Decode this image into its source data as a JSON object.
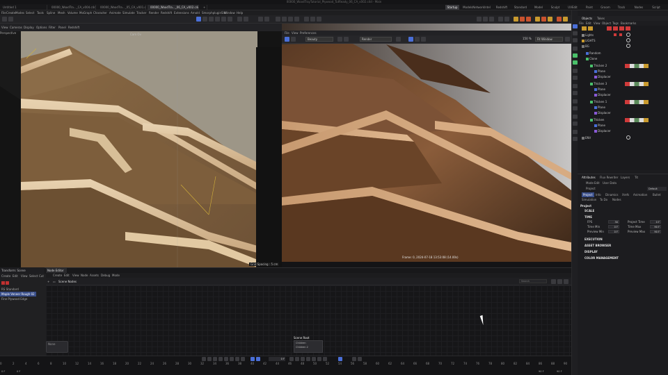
{
  "window": {
    "title": "00000_WoodTrayTutorial_Plywood_TutReady_06_CA_v002.c4d - Main"
  },
  "doc_tabs": [
    "Untitled 1",
    "00000_WoodTra..._CA_v004.c4d",
    "00000_WoodTra..._05_CA_v001.c4d",
    "00000_WoodTra..._06_CA_v002.c4d",
    "+"
  ],
  "layout_tabs": [
    "Startup",
    "ModelsNetworkIntel",
    "Redshift",
    "Standard",
    "Model",
    "Sculpt",
    "UVEdit",
    "Paint",
    "Groom",
    "Track",
    "Nodes",
    "Script"
  ],
  "menus": [
    "File",
    "Create",
    "Modes",
    "Select",
    "Tools",
    "Spline",
    "Mesh",
    "Volume",
    "MoGraph",
    "Character",
    "Animate",
    "Simulate",
    "Tracker",
    "Render",
    "Redshift",
    "Extensions",
    "Arnold",
    "SmorphpluginSite",
    "Window",
    "Help"
  ],
  "left_viewport": {
    "menu": [
      "View",
      "Cameras",
      "Display",
      "Options",
      "Filter",
      "Panel",
      "Redshift"
    ],
    "perspective_label": "Perspective",
    "camera_label": "Cam",
    "camera_value": "Ov",
    "grid_spacing": "Grid Spacing : 5 cm"
  },
  "right_viewport": {
    "menu": [
      "File",
      "View",
      "Preferences"
    ],
    "beauty_select": "Beauty",
    "render_label": "Render",
    "zoom": "150 %",
    "fit_label": "Fit Window",
    "frame_info": "Frame: 0,  2024-07-18  13:53:08  (14.00s)"
  },
  "node_editor": {
    "transform_tab": "Transform: Scene",
    "tab": "Node Editor",
    "menu": [
      "Create",
      "Edit",
      "View",
      "Node",
      "Assets",
      "Debug",
      "Mode"
    ],
    "breadcrumb": "Scene Nodes",
    "search_placeholder": "Search",
    "scene_root": "Scene Root",
    "children": [
      "Children",
      "Children 2"
    ],
    "none_node": "None",
    "left_menu": [
      "Create",
      "Edit",
      "View",
      "Select",
      "Cut"
    ],
    "left_items": [
      "RS Standard",
      "Maple Veneer Rough 02",
      "Fine Plywood Edge"
    ]
  },
  "timeline": {
    "ticks": [
      "0",
      "2",
      "4",
      "6",
      "8",
      "10",
      "12",
      "14",
      "16",
      "18",
      "20",
      "22",
      "24",
      "26",
      "28",
      "30",
      "32",
      "34",
      "36",
      "38",
      "40",
      "42",
      "44",
      "46",
      "48",
      "50",
      "52",
      "54",
      "56",
      "58",
      "60",
      "62",
      "64",
      "66",
      "68",
      "70",
      "72",
      "74",
      "76",
      "78",
      "80",
      "82",
      "84",
      "86",
      "88",
      "90"
    ],
    "current_frame": "0 F",
    "start_frame": "0 F",
    "end_frame": "90 F",
    "end_frame_2": "90 F",
    "playhead_field": "0 F"
  },
  "objects_panel": {
    "tabs": [
      "Objects",
      "Takes"
    ],
    "menu": [
      "File",
      "Edit",
      "View",
      "Object",
      "Tags",
      "Bookmarks"
    ],
    "rows": [
      {
        "name": "Lights",
        "indent": 1
      },
      {
        "name": "LIGHTS",
        "indent": 1
      },
      {
        "name": "BG",
        "indent": 1
      },
      {
        "name": "Random",
        "indent": 2
      },
      {
        "name": "Clone",
        "indent": 2
      },
      {
        "name": "Thicken 2",
        "indent": 3
      },
      {
        "name": "Plane",
        "indent": 4
      },
      {
        "name": "Displacer",
        "indent": 4
      },
      {
        "name": "Thicken 3",
        "indent": 3
      },
      {
        "name": "Plane",
        "indent": 4
      },
      {
        "name": "Displacer",
        "indent": 4
      },
      {
        "name": "Thicken 1",
        "indent": 3
      },
      {
        "name": "Plane",
        "indent": 4
      },
      {
        "name": "Displacer",
        "indent": 4
      },
      {
        "name": "Thicken",
        "indent": 3
      },
      {
        "name": "Plane",
        "indent": 4
      },
      {
        "name": "Displacer",
        "indent": 4
      },
      {
        "name": "ENV",
        "indent": 1
      }
    ]
  },
  "attributes_panel": {
    "tabs": [
      "Attributes",
      "Flux Rewriter",
      "Layers",
      "Tit"
    ],
    "menu": [
      "Mode",
      "Edit",
      "User Data"
    ],
    "object_label": "Project",
    "default_label": "Default",
    "subtabs": [
      "Project",
      "Info",
      "Dinamics",
      "Xrefs",
      "Animation",
      "Bullet",
      "Simulation",
      "To Do",
      "Nodes"
    ],
    "section_project": "Project",
    "section_scale": "SCALE",
    "section_time": "TIME",
    "fps_label": "FPS",
    "fps_value": "30",
    "project_time_label": "Project Time",
    "project_time_value": "0 F",
    "min_time_label": "Time Min",
    "min_time_value": "0 F",
    "max_time_label": "Time Max",
    "max_time_value": "90 F",
    "preview_min_label": "Preview Min",
    "preview_min_value": "0 F",
    "preview_max_label": "Preview Max",
    "preview_max_value": "90 F",
    "section_execution": "EXECUTION",
    "section_asset": "ASSET BROWSER",
    "section_display": "DISPLAY",
    "section_color": "COLOR MANAGEMENT"
  },
  "colors": {
    "accent_blue": "#4a6fd8",
    "active_green": "#4ac06a",
    "red_tag": "#d03a3a"
  }
}
